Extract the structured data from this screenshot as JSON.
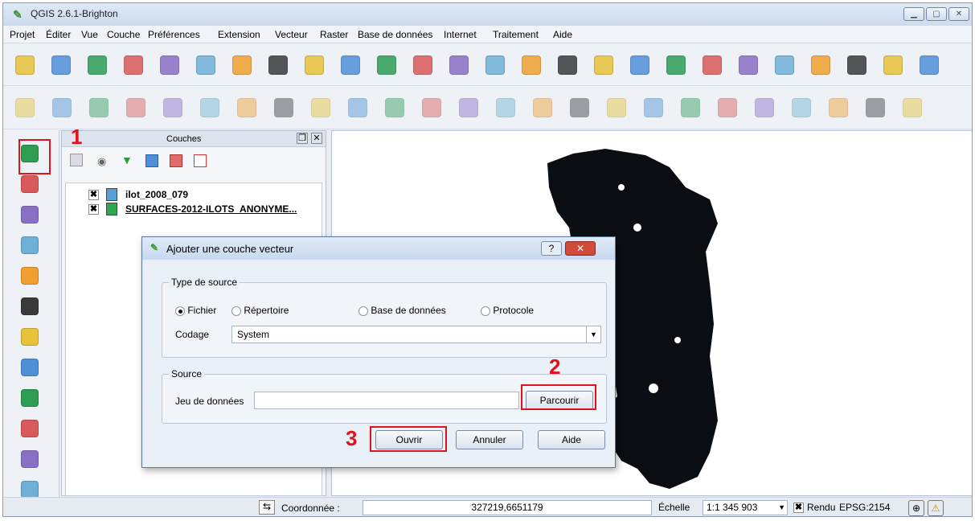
{
  "app": {
    "title": "QGIS 2.6.1-Brighton"
  },
  "menu": [
    "Projet",
    "Éditer",
    "Vue",
    "Couche",
    "Préférences",
    "Extension",
    "Vecteur",
    "Raster",
    "Base de données",
    "Internet",
    "Traitement",
    "Aide"
  ],
  "layers_panel": {
    "title": "Couches",
    "items": [
      {
        "name": "ilot_2008_079",
        "color": "#5a9ed6",
        "checked": true
      },
      {
        "name": "SURFACES-2012-ILOTS_ANONYME...",
        "color": "#2ea84f",
        "checked": true
      }
    ]
  },
  "annotations": {
    "n1": "1",
    "n2": "2",
    "n3": "3"
  },
  "dialog": {
    "title": "Ajouter une couche vecteur",
    "help": "?",
    "close": "✕",
    "source_type_label": "Type de source",
    "radios": [
      {
        "label": "Fichier",
        "selected": true
      },
      {
        "label": "Répertoire",
        "selected": false
      },
      {
        "label": "Base de données",
        "selected": false
      },
      {
        "label": "Protocole",
        "selected": false
      }
    ],
    "encoding_label": "Codage",
    "encoding_value": "System",
    "source_label": "Source",
    "dataset_label": "Jeu de données",
    "dataset_value": "",
    "browse": "Parcourir",
    "open": "Ouvrir",
    "cancel": "Annuler",
    "help_btn": "Aide"
  },
  "status": {
    "coord_label": "Coordonnée :",
    "coord_value": "327219,6651179",
    "scale_label": "Échelle",
    "scale_value": "1:1 345 903",
    "render_label": "Rendu",
    "crs": "EPSG:2154"
  },
  "icons": {
    "toolbar1": [
      "new-project-icon",
      "open-project-icon",
      "save-project-icon",
      "save-as-icon",
      "new-print-composer-icon",
      "composer-manager-icon",
      "touch-zoom-icon",
      "pan-icon",
      "pan-to-selection-icon",
      "zoom-in-icon",
      "zoom-out-icon",
      "zoom-native-icon",
      "zoom-full-icon",
      "zoom-to-selection-icon",
      "zoom-to-layer-icon",
      "zoom-last-icon",
      "zoom-next-icon",
      "refresh-icon",
      "identify-icon",
      "run-feature-action-icon",
      "select-feature-icon",
      "deselect-icon",
      "field-calculator-icon",
      "attribute-table-icon",
      "statistics-icon",
      "measure-icon"
    ],
    "toolbar2": [
      "current-edits-icon",
      "toggle-editing-icon",
      "save-edits-icon",
      "add-feature-icon",
      "move-feature-icon",
      "node-tool-icon",
      "delete-selected-icon",
      "cut-features-icon",
      "copy-features-icon",
      "paste-features-icon",
      "undo-icon",
      "redo-icon",
      "simplify-icon",
      "add-ring-icon",
      "add-part-icon",
      "fill-ring-icon",
      "delete-ring-icon",
      "delete-part-icon",
      "reshape-icon",
      "offset-curve-icon",
      "split-features-icon",
      "split-parts-icon",
      "merge-features-icon",
      "merge-attributes-icon",
      "rotate-point-symbols-icon"
    ],
    "left": [
      "add-vector-layer-icon",
      "add-raster-layer-icon",
      "add-postgis-layer-icon",
      "add-spatialite-layer-icon",
      "add-mssql-layer-icon",
      "add-oracle-layer-icon",
      "add-wms-layer-icon",
      "add-wcs-layer-icon",
      "add-wfs-layer-icon",
      "more-icon",
      "add-delimited-text-icon",
      "more-2-icon"
    ]
  }
}
